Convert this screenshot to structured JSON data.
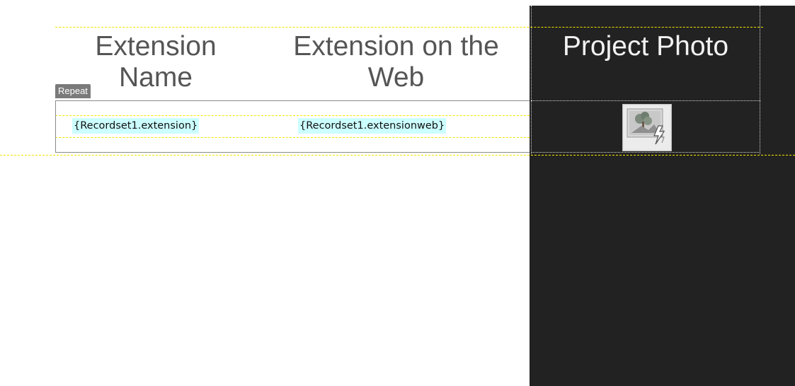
{
  "headers": {
    "extension_name": "Extension Name",
    "extension_web": "Extension on the Web",
    "project_photo": "Project Photo"
  },
  "repeat_region": {
    "label": "Repeat"
  },
  "bindings": {
    "extension": "{Recordset1.extension}",
    "extension_web": "{Recordset1.extensionweb}"
  },
  "image_placeholder": {
    "icon": "dynamic-image-placeholder-icon"
  },
  "colors": {
    "guide": "#f2e600",
    "binding_highlight": "#ccffff",
    "dark_column": "#222222",
    "repeat_tab": "#7a7a7a"
  }
}
